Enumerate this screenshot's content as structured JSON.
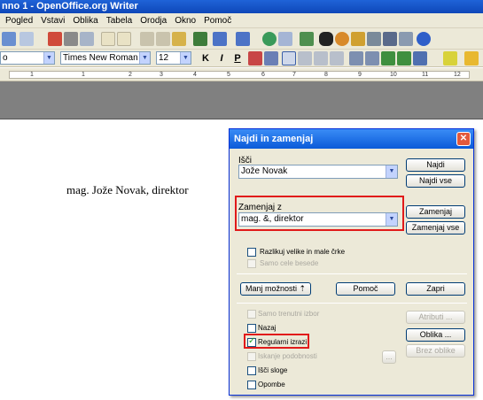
{
  "window": {
    "title": "nno 1 - OpenOffice.org Writer"
  },
  "menu": [
    "Pogled",
    "Vstavi",
    "Oblika",
    "Tabela",
    "Orodja",
    "Okno",
    "Pomoč"
  ],
  "format_bar": {
    "style_value": "o",
    "font_value": "Times New Roman",
    "size_value": "12",
    "bold": "K",
    "italic": "I",
    "underline": "P"
  },
  "ruler_ticks": [
    "1",
    "1",
    "2",
    "3",
    "4",
    "5",
    "6",
    "7",
    "8",
    "9",
    "10",
    "11",
    "12"
  ],
  "document": {
    "text": "mag. Jože Novak, direktor"
  },
  "dialog": {
    "title": "Najdi in zamenjaj",
    "search_label": "Išči",
    "search_value": "Jože Novak",
    "replace_label": "Zamenjaj z",
    "replace_value": "mag. &, direktor",
    "find_button": "Najdi",
    "find_all_button": "Najdi vse",
    "replace_button": "Zamenjaj",
    "replace_all_button": "Zamenjaj vse",
    "match_case": "Razlikuj velike in male črke",
    "whole_words": "Samo cele besede",
    "less_options_button": "Manj možnosti",
    "help_button": "Pomoč",
    "close_button": "Zapri",
    "current_selection": "Samo trenutni izbor",
    "backwards": "Nazaj",
    "regex": "Regularni izrazi",
    "similarity": "Iskanje podobnosti",
    "styles": "Išči sloge",
    "comments": "Opombe",
    "similarity_button": "...",
    "attributes_button": "Atributi ...",
    "format_button": "Oblika ...",
    "no_format_button": "Brez oblike"
  }
}
